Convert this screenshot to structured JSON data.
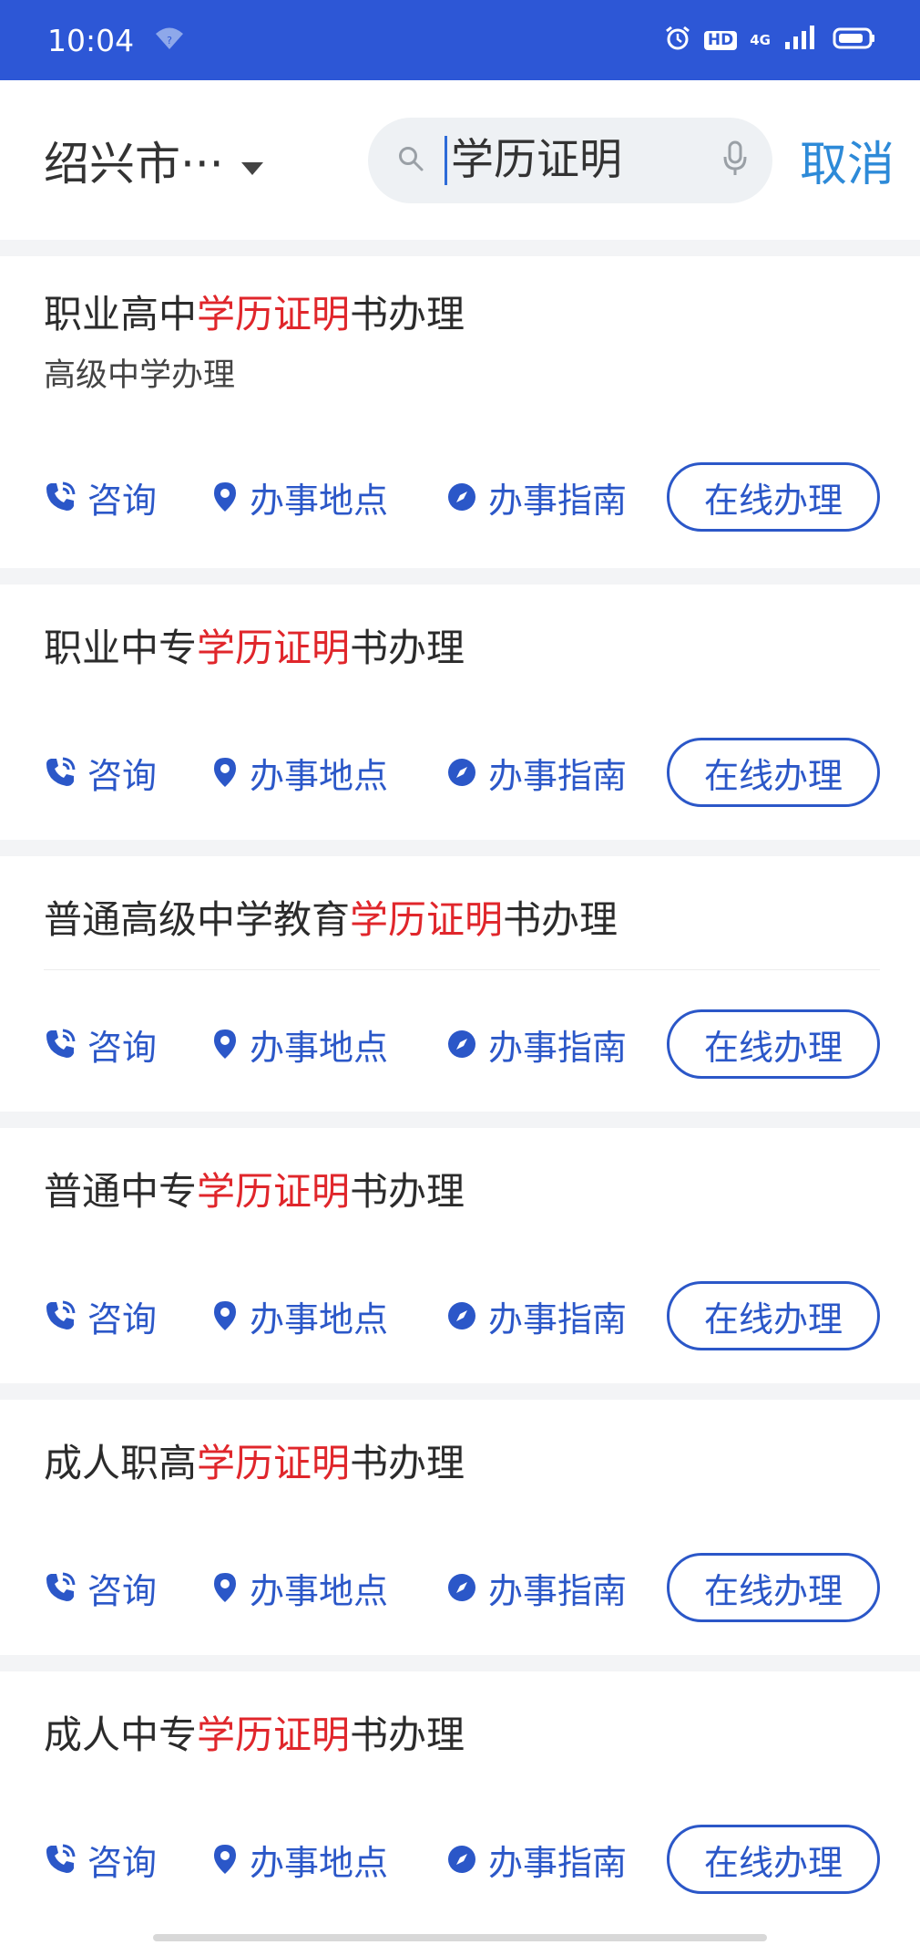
{
  "status_bar": {
    "time": "10:04",
    "hd": "HD",
    "network": "4G"
  },
  "header": {
    "city": "绍兴市···",
    "search_value": "学历证明",
    "cancel_label": "取消"
  },
  "results": [
    {
      "title_pre": "职业高中",
      "title_hl": "学历证明",
      "title_post": "书办理",
      "subtitle": "高级中学办理",
      "consult": "咨询",
      "place": "办事地点",
      "guide": "办事指南",
      "online": "在线办理"
    },
    {
      "title_pre": "职业中专",
      "title_hl": "学历证明",
      "title_post": "书办理",
      "subtitle": "",
      "consult": "咨询",
      "place": "办事地点",
      "guide": "办事指南",
      "online": "在线办理"
    },
    {
      "title_pre": "普通高级中学教育",
      "title_hl": "学历证明",
      "title_post": "书办理",
      "subtitle": "",
      "consult": "咨询",
      "place": "办事地点",
      "guide": "办事指南",
      "online": "在线办理"
    },
    {
      "title_pre": "普通中专",
      "title_hl": "学历证明",
      "title_post": "书办理",
      "subtitle": "",
      "consult": "咨询",
      "place": "办事地点",
      "guide": "办事指南",
      "online": "在线办理"
    },
    {
      "title_pre": "成人职高",
      "title_hl": "学历证明",
      "title_post": "书办理",
      "subtitle": "",
      "consult": "咨询",
      "place": "办事地点",
      "guide": "办事指南",
      "online": "在线办理"
    },
    {
      "title_pre": "成人中专",
      "title_hl": "学历证明",
      "title_post": "书办理",
      "subtitle": "",
      "consult": "咨询",
      "place": "办事地点",
      "guide": "办事指南",
      "online": "在线办理"
    }
  ],
  "colors": {
    "status_bar": "#2d57d6",
    "highlight": "#e0262b",
    "action": "#2b57c8",
    "cancel": "#2d8ad8"
  },
  "icons": {
    "consult": "phone-icon",
    "place": "location-pin-icon",
    "guide": "compass-icon"
  }
}
